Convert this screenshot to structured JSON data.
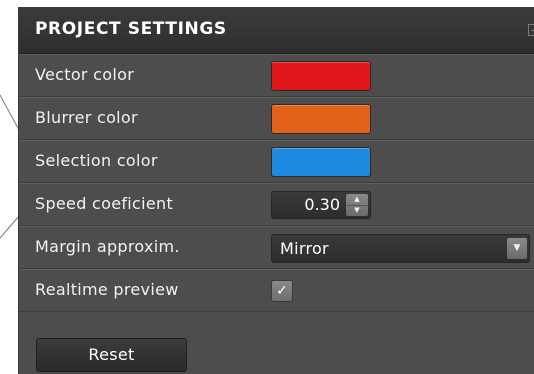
{
  "panel": {
    "title": "PROJECT SETTINGS",
    "collapse_icon": "collapse-icon"
  },
  "rows": [
    {
      "label": "Vector color",
      "type": "color",
      "color": "#e0161b"
    },
    {
      "label": "Blurrer color",
      "type": "color",
      "color": "#e2621a"
    },
    {
      "label": "Selection color",
      "type": "color",
      "color": "#1e8ae0"
    },
    {
      "label": "Speed coeficient",
      "type": "spinner",
      "value": "0.30"
    },
    {
      "label": "Margin approxim.",
      "type": "select",
      "value": "Mirror"
    },
    {
      "label": "Realtime preview",
      "type": "checkbox",
      "checked": true
    }
  ],
  "glyphs": {
    "checkmark": "✓",
    "spin_up": "▲",
    "spin_down": "▼",
    "dropdown_arrow": "▼"
  },
  "reset_label": "Reset"
}
